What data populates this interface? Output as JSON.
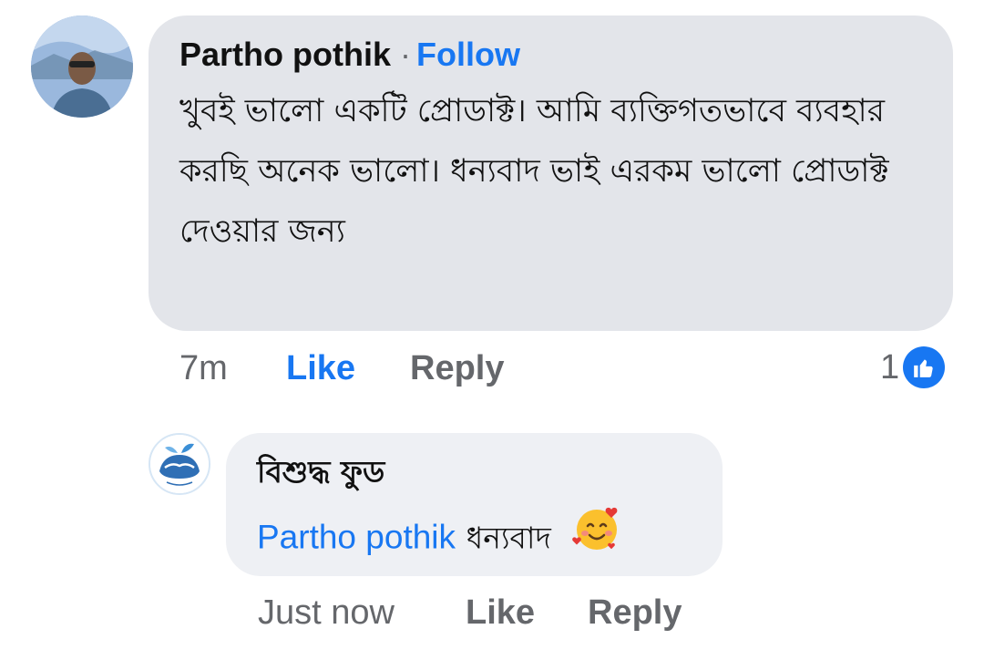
{
  "comment": {
    "author": "Partho pothik",
    "separator": "·",
    "follow_label": "Follow",
    "text": "খুবই ভালো একটি প্রোডাক্ট।  আমি ব্যক্তিগতভাবে ব্যবহার করছি অনেক ভালো। ধন্যবাদ ভাই এরকম ভালো প্রোডাক্ট দেওয়ার জন্য",
    "time": "7m",
    "like_label": "Like",
    "reply_label": "Reply",
    "reaction_count": "1",
    "reaction_icon": "thumbs-up-icon"
  },
  "reply": {
    "author": "বিশুদ্ধ ফুড",
    "mention": "Partho pothik",
    "text": "ধন্যবাদ",
    "emoji": "smiling-face-with-hearts",
    "time": "Just now",
    "like_label": "Like",
    "reply_label": "Reply"
  },
  "colors": {
    "accent": "#1877f2",
    "bubble_main": "#e3e5ea",
    "bubble_reply": "#eef0f4",
    "muted_text": "#65676b"
  }
}
